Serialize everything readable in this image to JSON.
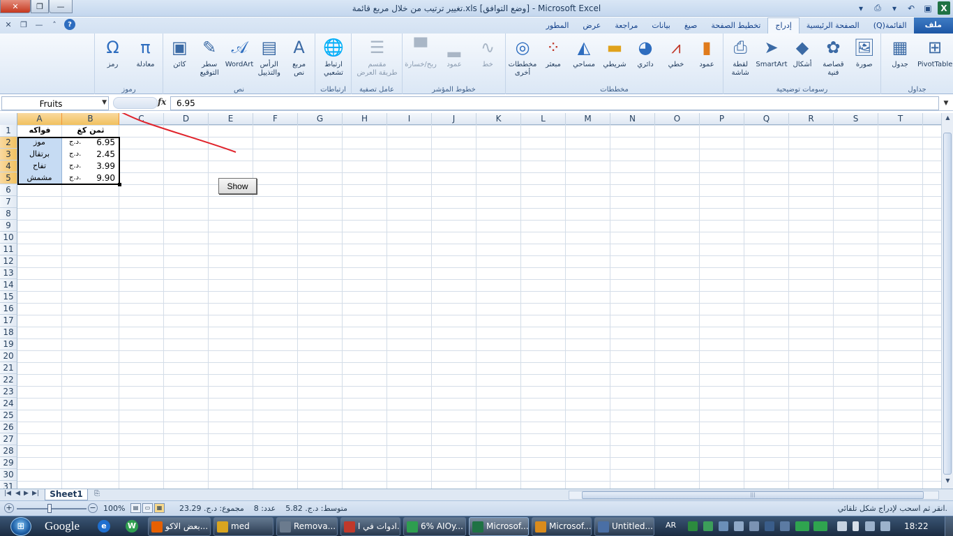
{
  "window": {
    "title": "تغيير ترتيب من خلال مربع قائمة.xls  [وضع التوافق] - Microsoft Excel",
    "close": "✕",
    "maximize": "❐",
    "minimize": "—"
  },
  "ribbon_tabs": [
    "ملف",
    "الصفحة الرئيسية",
    "إدراج",
    "تخطيط الصفحة",
    "صيغ",
    "بيانات",
    "مراجعة",
    "عرض",
    "المطور"
  ],
  "qat_extra": "(Q)القائمة",
  "ribbon": {
    "groups": [
      {
        "label": "جداول",
        "buttons": [
          {
            "label": "PivotTable",
            "icon": "pivot-table-icon"
          },
          {
            "label": "جدول",
            "icon": "table-icon"
          }
        ]
      },
      {
        "label": "رسومات توضيحية",
        "buttons": [
          {
            "label": "صورة",
            "icon": "picture-icon"
          },
          {
            "label": "قصاصة\nفنية",
            "icon": "clip-art-icon"
          },
          {
            "label": "أشكال",
            "icon": "shapes-icon"
          },
          {
            "label": "SmartArt",
            "icon": "smartart-icon"
          },
          {
            "label": "لقطة\nشاشة",
            "icon": "screenshot-icon"
          }
        ]
      },
      {
        "label": "مخططات",
        "buttons": [
          {
            "label": "عمود",
            "icon": "column-chart-icon"
          },
          {
            "label": "خطي",
            "icon": "line-chart-icon"
          },
          {
            "label": "دائري",
            "icon": "pie-chart-icon"
          },
          {
            "label": "شريطي",
            "icon": "bar-chart-icon"
          },
          {
            "label": "مساحي",
            "icon": "area-chart-icon"
          },
          {
            "label": "مبعثر",
            "icon": "scatter-chart-icon"
          },
          {
            "label": "مخططات\nأخرى",
            "icon": "other-charts-icon"
          }
        ]
      },
      {
        "label": "خطوط المؤشر",
        "buttons": [
          {
            "label": "خط",
            "icon": "sparkline-line-icon"
          },
          {
            "label": "عمود",
            "icon": "sparkline-column-icon"
          },
          {
            "label": "ربح/خسارة",
            "icon": "sparkline-winloss-icon"
          }
        ]
      },
      {
        "label": "عامل تصفية",
        "buttons": [
          {
            "label": "مقسم\nطريقة العرض",
            "icon": "slicer-icon"
          }
        ]
      },
      {
        "label": "ارتباطات",
        "buttons": [
          {
            "label": "ارتباط\nتشعبي",
            "icon": "hyperlink-icon"
          }
        ]
      },
      {
        "label": "نص",
        "buttons": [
          {
            "label": "مربع\nنص",
            "icon": "text-box-icon"
          },
          {
            "label": "الرأس\nوالتذييل",
            "icon": "header-footer-icon"
          },
          {
            "label": "WordArt",
            "icon": "wordart-icon"
          },
          {
            "label": "سطر\nالتوقيع",
            "icon": "signature-line-icon"
          },
          {
            "label": "كائن",
            "icon": "object-icon"
          }
        ]
      },
      {
        "label": "رموز",
        "buttons": [
          {
            "label": "معادلة",
            "icon": "equation-icon"
          },
          {
            "label": "رمز",
            "icon": "symbol-icon"
          }
        ]
      }
    ]
  },
  "formula_bar": {
    "name_box": "Fruits",
    "fx": "fx",
    "value": "6.95"
  },
  "columns": [
    "A",
    "B",
    "C",
    "D",
    "E",
    "F",
    "G",
    "H",
    "I",
    "J",
    "K",
    "L",
    "M",
    "N",
    "O",
    "P",
    "Q",
    "R",
    "S",
    "T"
  ],
  "rows": [
    "1",
    "2",
    "3",
    "4",
    "5",
    "6",
    "7",
    "8",
    "9",
    "10",
    "11",
    "12",
    "13",
    "14",
    "15",
    "16",
    "17",
    "18",
    "19",
    "20",
    "21",
    "22",
    "23",
    "24",
    "25",
    "26",
    "27",
    "28",
    "29",
    "30",
    "31"
  ],
  "sheet": {
    "header_fruit": "فواكه",
    "header_price": "ثمن كغ",
    "currency": "د.ج.",
    "items": [
      {
        "fruit": "موز",
        "price": "6.95"
      },
      {
        "fruit": "برتقال",
        "price": "2.45"
      },
      {
        "fruit": "تفاح",
        "price": "3.99"
      },
      {
        "fruit": "مشمش",
        "price": "9.90"
      }
    ]
  },
  "show_button": "Show",
  "sheet_tabs": {
    "active": "Sheet1"
  },
  "status": {
    "message": "انقر ثم اسحب لإدراج شكل تلقائي.",
    "average": "متوسط:  د.ج. 5.82",
    "count": "عدد:  8",
    "sum": "مجموع:  د.ج. 23.29",
    "zoom": "100%"
  },
  "taskbar": {
    "google": "Google",
    "items": [
      {
        "label": "بعض الاكو...",
        "icon": "firefox-icon",
        "color": "#e66000"
      },
      {
        "label": "med",
        "icon": "folder-icon",
        "color": "#d9a520"
      },
      {
        "label": "Remova...",
        "icon": "drive-icon",
        "color": "#6b7b8e"
      },
      {
        "label": "ادوات في ا...",
        "icon": "book-icon",
        "color": "#c0392b"
      },
      {
        "label": "6% AIOy...",
        "icon": "download-icon",
        "color": "#2e9e4f"
      },
      {
        "label": "Microsof...",
        "icon": "excel-icon",
        "color": "#1f7244"
      },
      {
        "label": "Microsof...",
        "icon": "paint-icon",
        "color": "#d98b1c"
      },
      {
        "label": "Untitled....",
        "icon": "image-editor-icon",
        "color": "#4a6fa5"
      }
    ],
    "lang": "AR",
    "clock": "18:22"
  },
  "colors": {
    "accent": "#1d57a6",
    "selection": "#c6dbf3",
    "arrow": "#e0232b",
    "excel": "#1f7244"
  }
}
